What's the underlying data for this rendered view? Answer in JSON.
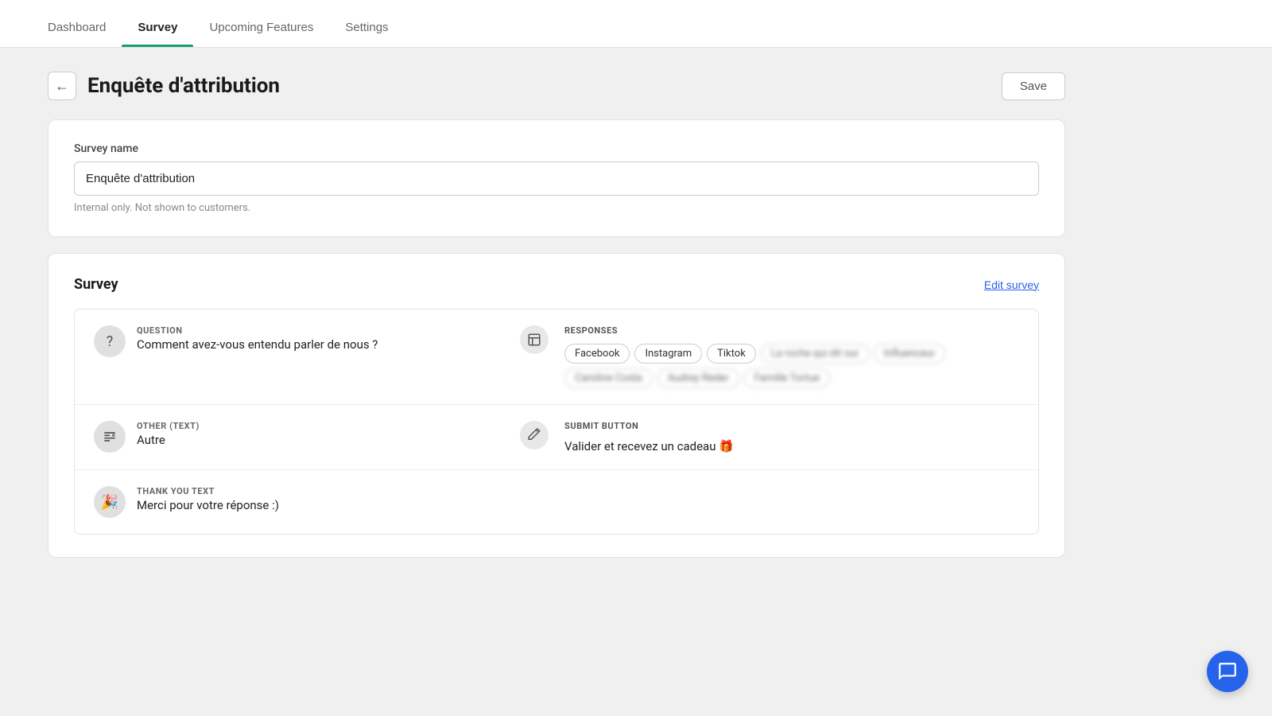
{
  "nav": {
    "tabs": [
      {
        "id": "dashboard",
        "label": "Dashboard",
        "active": false
      },
      {
        "id": "survey",
        "label": "Survey",
        "active": true
      },
      {
        "id": "upcoming",
        "label": "Upcoming Features",
        "active": false
      },
      {
        "id": "settings",
        "label": "Settings",
        "active": false
      }
    ]
  },
  "header": {
    "back_label": "←",
    "title": "Enquête d'attribution",
    "save_label": "Save"
  },
  "survey_name_section": {
    "field_label": "Survey name",
    "field_value": "Enquête d'attribution",
    "field_hint": "Internal only. Not shown to customers."
  },
  "survey_section": {
    "title": "Survey",
    "edit_label": "Edit survey",
    "rows": [
      {
        "id": "question",
        "type_label": "QUESTION",
        "value": "Comment avez-vous entendu parler de nous ?",
        "icon": "?",
        "has_action_icon": true,
        "right_type": "responses",
        "responses_label": "RESPONSES",
        "tags": [
          {
            "label": "Facebook",
            "blurred": false
          },
          {
            "label": "Instagram",
            "blurred": false
          },
          {
            "label": "Tiktok",
            "blurred": false
          },
          {
            "label": "La roche qui dit oui",
            "blurred": true
          },
          {
            "label": "Influenceur",
            "blurred": true
          },
          {
            "label": "Caroline Costa",
            "blurred": true
          },
          {
            "label": "Audrey Reder",
            "blurred": true
          },
          {
            "label": "Famille Tortue",
            "blurred": true
          }
        ]
      },
      {
        "id": "other_text",
        "type_label": "OTHER (TEXT)",
        "value": "Autre",
        "icon": "Aa",
        "has_action_icon": true,
        "right_type": "submit",
        "submit_label": "SUBMIT BUTTON",
        "submit_value": "Valider et recevez un cadeau 🎁"
      },
      {
        "id": "thank_you",
        "type_label": "THANK YOU TEXT",
        "value": "Merci pour votre réponse :)",
        "icon": "🎉",
        "has_action_icon": false
      }
    ]
  }
}
